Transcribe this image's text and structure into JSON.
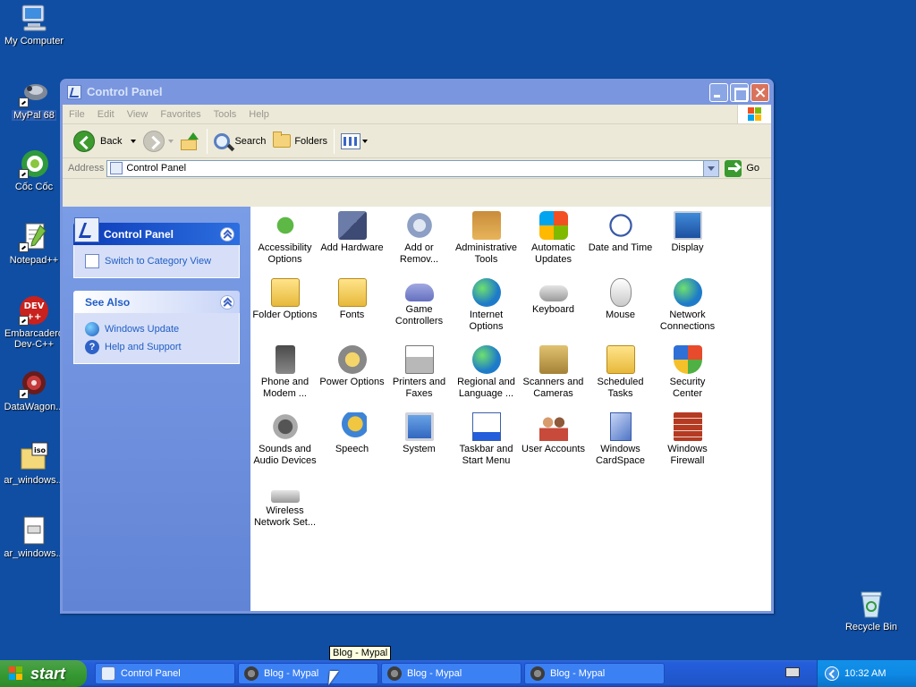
{
  "desktop": {
    "icons": [
      {
        "label": "My Computer",
        "icon": "computer-icon"
      },
      {
        "label": "MyPal 68",
        "icon": "mypal-icon",
        "selected": true
      },
      {
        "label": "Cốc Cốc",
        "icon": "coccoc-icon"
      },
      {
        "label": "Notepad++",
        "icon": "notepadpp-icon"
      },
      {
        "label": "Embarcadero Dev-C++",
        "label_line1": "Embarcadero",
        "label_line2": "Dev-C++",
        "icon": "devcpp-icon"
      },
      {
        "label": "DataWagon...",
        "icon": "datawagon-icon"
      },
      {
        "label": "ar_windows...",
        "icon": "iso-icon"
      },
      {
        "label": "ar_windows...",
        "icon": "file-icon"
      },
      {
        "label": "Recycle Bin",
        "icon": "recycle-bin-icon"
      }
    ]
  },
  "window": {
    "title": "Control Panel",
    "menu": [
      "File",
      "Edit",
      "View",
      "Favorites",
      "Tools",
      "Help"
    ],
    "toolbar": {
      "back": "Back",
      "search": "Search",
      "folders": "Folders"
    },
    "address": {
      "label": "Address",
      "value": "Control Panel",
      "go": "Go"
    },
    "taskpane": {
      "main_title": "Control Panel",
      "switch_link": "Switch to Category View",
      "see_also_title": "See Also",
      "see_also": [
        "Windows Update",
        "Help and Support"
      ]
    },
    "items": [
      {
        "l1": "Accessibility",
        "l2": "Options",
        "icon": "accessibility-icon",
        "cls": "g-a"
      },
      {
        "l1": "Add Hardware",
        "l2": "",
        "icon": "add-hardware-icon",
        "cls": "g-b"
      },
      {
        "l1": "Add or",
        "l2": "Remov...",
        "icon": "add-remove-programs-icon",
        "cls": "g-c"
      },
      {
        "l1": "Administrative",
        "l2": "Tools",
        "icon": "administrative-tools-icon",
        "cls": "g-d"
      },
      {
        "l1": "Automatic",
        "l2": "Updates",
        "icon": "automatic-updates-icon",
        "cls": "g-e"
      },
      {
        "l1": "Date and Time",
        "l2": "",
        "icon": "date-time-icon",
        "cls": "g-f"
      },
      {
        "l1": "Display",
        "l2": "",
        "icon": "display-icon",
        "cls": "g-g"
      },
      {
        "l1": "Folder Options",
        "l2": "",
        "icon": "folder-options-icon",
        "cls": "g-fold"
      },
      {
        "l1": "Fonts",
        "l2": "",
        "icon": "fonts-icon",
        "cls": "g-fold"
      },
      {
        "l1": "Game",
        "l2": "Controllers",
        "icon": "game-controllers-icon",
        "cls": "g-pad"
      },
      {
        "l1": "Internet",
        "l2": "Options",
        "icon": "internet-options-icon",
        "cls": "g-globe"
      },
      {
        "l1": "Keyboard",
        "l2": "",
        "icon": "keyboard-icon",
        "cls": "g-kb"
      },
      {
        "l1": "Mouse",
        "l2": "",
        "icon": "mouse-icon",
        "cls": "g-mouse"
      },
      {
        "l1": "Network",
        "l2": "Connections",
        "icon": "network-connections-icon",
        "cls": "g-globe"
      },
      {
        "l1": "Phone and",
        "l2": "Modem ...",
        "icon": "phone-modem-icon",
        "cls": "g-phone"
      },
      {
        "l1": "Power Options",
        "l2": "",
        "icon": "power-options-icon",
        "cls": "g-power"
      },
      {
        "l1": "Printers and",
        "l2": "Faxes",
        "icon": "printers-faxes-icon",
        "cls": "g-print"
      },
      {
        "l1": "Regional and",
        "l2": "Language ...",
        "icon": "regional-language-icon",
        "cls": "g-globe"
      },
      {
        "l1": "Scanners and",
        "l2": "Cameras",
        "icon": "scanners-cameras-icon",
        "cls": "g-scan"
      },
      {
        "l1": "Scheduled",
        "l2": "Tasks",
        "icon": "scheduled-tasks-icon",
        "cls": "g-fold"
      },
      {
        "l1": "Security",
        "l2": "Center",
        "icon": "security-center-icon",
        "cls": "g-shield"
      },
      {
        "l1": "Sounds and",
        "l2": "Audio Devices",
        "icon": "sounds-audio-icon",
        "cls": "g-speaker"
      },
      {
        "l1": "Speech",
        "l2": "",
        "icon": "speech-icon",
        "cls": "g-speech"
      },
      {
        "l1": "System",
        "l2": "",
        "icon": "system-icon",
        "cls": "g-pc"
      },
      {
        "l1": "Taskbar and",
        "l2": "Start Menu",
        "icon": "taskbar-start-menu-icon",
        "cls": "g-task"
      },
      {
        "l1": "User Accounts",
        "l2": "",
        "icon": "user-accounts-icon",
        "cls": "g-users"
      },
      {
        "l1": "Windows",
        "l2": "CardSpace",
        "icon": "windows-cardspace-icon",
        "cls": "g-card"
      },
      {
        "l1": "Windows",
        "l2": "Firewall",
        "icon": "windows-firewall-icon",
        "cls": "g-fw"
      },
      {
        "l1": "Wireless",
        "l2": "Network Set...",
        "icon": "wireless-network-setup-icon",
        "cls": "g-wifi"
      }
    ]
  },
  "taskbar": {
    "start": "start",
    "tasks": [
      {
        "label": "Control Panel",
        "icon": "control-panel-icon"
      },
      {
        "label": "Blog - Mypal",
        "icon": "mypal-icon"
      },
      {
        "label": "Blog - Mypal",
        "icon": "mypal-icon"
      },
      {
        "label": "Blog - Mypal",
        "icon": "mypal-icon"
      }
    ],
    "clock": "10:32 AM"
  },
  "tooltip": "Blog - Mypal",
  "colors": {
    "desktop": "#0f4ea3",
    "titlebar_inactive": "#7a96df",
    "taskbar": "#245edb",
    "start": "#379a33",
    "link": "#215dc6"
  }
}
